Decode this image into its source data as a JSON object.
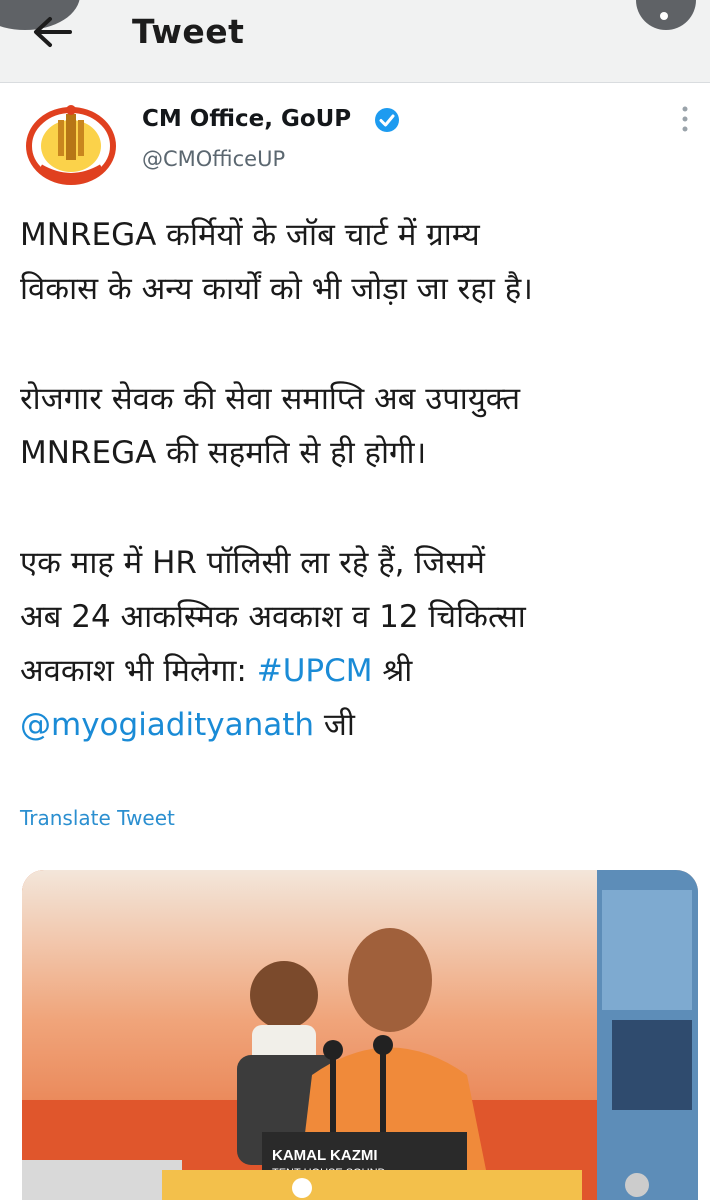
{
  "header": {
    "title": "Tweet",
    "back_icon": "back-arrow-icon"
  },
  "tweet": {
    "author_name": "CM Office, GoUP",
    "author_handle": "@CMOfficeUP",
    "verified_color": "#1d9bf0",
    "para1_line1": "MNREGA कर्मियों के जॉब चार्ट में ग्राम्य",
    "para1_line2": "विकास के अन्य कार्यों को भी जोड़ा जा रहा है।",
    "para2_line1": "रोजगार सेवक की सेवा समाप्ति अब उपायुक्त",
    "para2_line2": "MNREGA की सहमति से ही होगी।",
    "para3_line1": "एक माह में HR पॉलिसी ला रहे हैं, जिसमें",
    "para3_line2": "अब 24 आकस्मिक अवकाश व 12 चिकित्सा",
    "para3_line3_text": "अवकाश भी मिलेगा: ",
    "hashtag": "#UPCM",
    "para3_line3_after": " श्री",
    "mention": "@myogiadityanath",
    "para3_line4_after": " जी",
    "translate_label": "Translate Tweet"
  },
  "media": {
    "sign_line1": "KAMAL  KAZMI",
    "sign_line2": "TENT HOUSE   SOUND",
    "accent_color": "#e8763a"
  },
  "colors": {
    "link": "#1a8bd6",
    "appbar_bg": "#f1f2f2"
  }
}
